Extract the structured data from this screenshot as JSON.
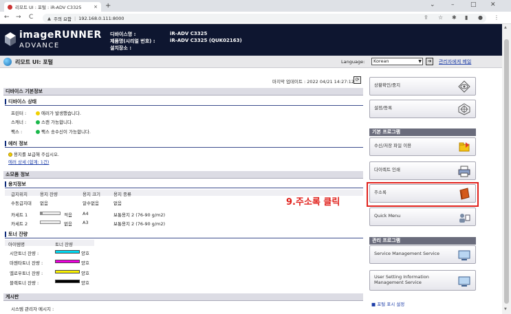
{
  "browser": {
    "tab_title": "리모트 UI : 포털 : iR-ADV C3325",
    "tab_close": "×",
    "new_tab": "+",
    "security_label": "주의 요함",
    "url": "192.168.0.111:8000",
    "win_chevron": "⌄",
    "win_min": "–",
    "win_max": "□",
    "win_close": "✕"
  },
  "header": {
    "brand_line1": "imageRUNNER",
    "brand_line2": "ADVANCE",
    "device_name_label": "디바이스명 :",
    "device_name_value": "iR-ADV C3325",
    "product_name_label": "제품명(시리얼 번호) :",
    "product_name_value": "iR-ADV C3325 (QUK02163)",
    "location_label": "설치장소 :"
  },
  "portal": {
    "title": "리모트 UI: 포털",
    "language_label": "Language:",
    "language_value": "Korean",
    "admin_mail": "관리자에게 메일"
  },
  "main": {
    "last_update": "마지막 업데이트 : 2022 04/21 14:27:12",
    "device_basic_info": "디바이스 기본정보",
    "device_status": {
      "title": "디바이스 상태",
      "rows": [
        {
          "label": "프린터 :",
          "status": "에러가 발생했습니다.",
          "color": "#f0d000"
        },
        {
          "label": "스캐너 :",
          "status": "스캔 가능합니다.",
          "color": "#19b84a"
        },
        {
          "label": "팩스 :",
          "status": "팩스 송수신이 가능합니다.",
          "color": "#19b84a"
        }
      ]
    },
    "error_info": {
      "title": "에러 정보",
      "message": "용지를 보급해 주십시오.",
      "detail_link": "에러 상세 (합계: 1건)"
    },
    "consumables": "소모품 정보",
    "paper": {
      "title": "용지정보",
      "headers": [
        "급지위치",
        "용지 잔량",
        "용지 크기",
        "용지 종류"
      ],
      "rows": [
        {
          "source": "수동급지대",
          "level": "없음",
          "size": "알수없음",
          "type": "없음",
          "bar_fill": null
        },
        {
          "source": "카세트 1",
          "level": "적음",
          "size": "A4",
          "type": "보통용지 2 (76-90 g/m2)",
          "bar_fill": 0.1
        },
        {
          "source": "카세트 2",
          "level": "없음",
          "size": "A3",
          "type": "보통용지 2 (76-90 g/m2)",
          "bar_fill": 0
        }
      ]
    },
    "toner": {
      "title": "토너 잔량",
      "headers": [
        "아이템명",
        "토너 잔량"
      ],
      "rows": [
        {
          "name": "시안토너 잔량 :",
          "status": "양호",
          "color": "#00d8f0"
        },
        {
          "name": "마젠타토너 잔량 :",
          "status": "양호",
          "color": "#f000e0"
        },
        {
          "name": "옐로우토너 잔량 :",
          "status": "양호",
          "color": "#f8f000"
        },
        {
          "name": "블랙토너 잔량 :",
          "status": "양호",
          "color": "#000000"
        }
      ]
    },
    "bulletin": {
      "title": "게시판",
      "admin_message_label": "시스템 관리자 메시지 :"
    }
  },
  "right": {
    "status_monitor": "상황확인/중지",
    "settings": "설정/등록",
    "basic_programs": "기본 프로그램",
    "scan_send": "수신/저장 파일 이용",
    "direct_print": "다이렉트 인쇄",
    "address_book": "주소록",
    "quick_menu": "Quick Menu",
    "admin_programs": "관리 프로그램",
    "service_mgmt": "Service Management Service",
    "user_setting_1": "User Setting Information",
    "user_setting_2": "Management Service",
    "portal_display": "■ 포털 표시 설정"
  },
  "annotation": "9.주소록 클릭",
  "colors": {
    "highlight": "#e0201b",
    "header_bg": "#0e1630",
    "link": "#1d3ea8"
  }
}
